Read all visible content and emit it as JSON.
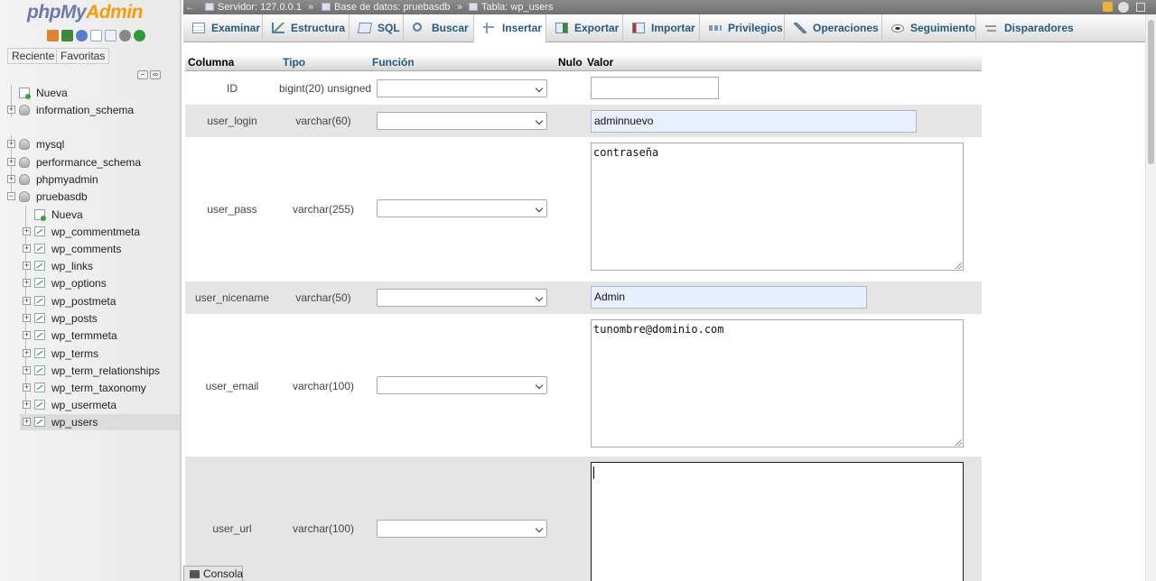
{
  "nav": {
    "logo_main": "phpMy",
    "logo_accent": "Admin",
    "tabs": {
      "recent": "Reciente",
      "favorites": "Favoritas"
    },
    "tree": [
      {
        "label": "Nueva",
        "kind": "new"
      },
      {
        "label": "information_schema",
        "kind": "db"
      },
      {
        "label": "mysql",
        "kind": "db"
      },
      {
        "label": "performance_schema",
        "kind": "db"
      },
      {
        "label": "phpmyadmin",
        "kind": "db"
      },
      {
        "label": "pruebasdb",
        "kind": "db",
        "expanded": true
      }
    ],
    "pruebasdb_children": [
      "Nueva",
      "wp_commentmeta",
      "wp_comments",
      "wp_links",
      "wp_options",
      "wp_postmeta",
      "wp_posts",
      "wp_termmeta",
      "wp_terms",
      "wp_term_relationships",
      "wp_term_taxonomy",
      "wp_usermeta",
      "wp_users"
    ],
    "selected_table": "wp_users"
  },
  "breadcrumb": {
    "server": "Servidor: 127.0.0.1",
    "database": "Base de datos: pruebasdb",
    "table": "Tabla: wp_users"
  },
  "menu": {
    "tabs": [
      "Examinar",
      "Estructura",
      "SQL",
      "Buscar",
      "Insertar",
      "Exportar",
      "Importar",
      "Privilegios",
      "Operaciones",
      "Seguimiento",
      "Disparadores"
    ],
    "active": "Insertar"
  },
  "form": {
    "headers": {
      "column": "Columna",
      "type": "Tipo",
      "function": "Función",
      "null": "Nulo",
      "value": "Valor"
    },
    "rows": [
      {
        "name": "ID",
        "type": "bigint(20) unsigned",
        "function": "",
        "value": ""
      },
      {
        "name": "user_login",
        "type": "varchar(60)",
        "function": "",
        "value": "adminnuevo"
      },
      {
        "name": "user_pass",
        "type": "varchar(255)",
        "function": "",
        "value": "contraseña"
      },
      {
        "name": "user_nicename",
        "type": "varchar(50)",
        "function": "",
        "value": "Admin"
      },
      {
        "name": "user_email",
        "type": "varchar(100)",
        "function": "",
        "value": "tunombre@dominio.com"
      },
      {
        "name": "user_url",
        "type": "varchar(100)",
        "function": "",
        "value": ""
      }
    ]
  },
  "console": {
    "label": "Consola"
  },
  "colors": {
    "link": "#235a81",
    "logo": "#6c78af",
    "logo_accent": "#f89c0e",
    "autofill": "#e8f0fe"
  }
}
